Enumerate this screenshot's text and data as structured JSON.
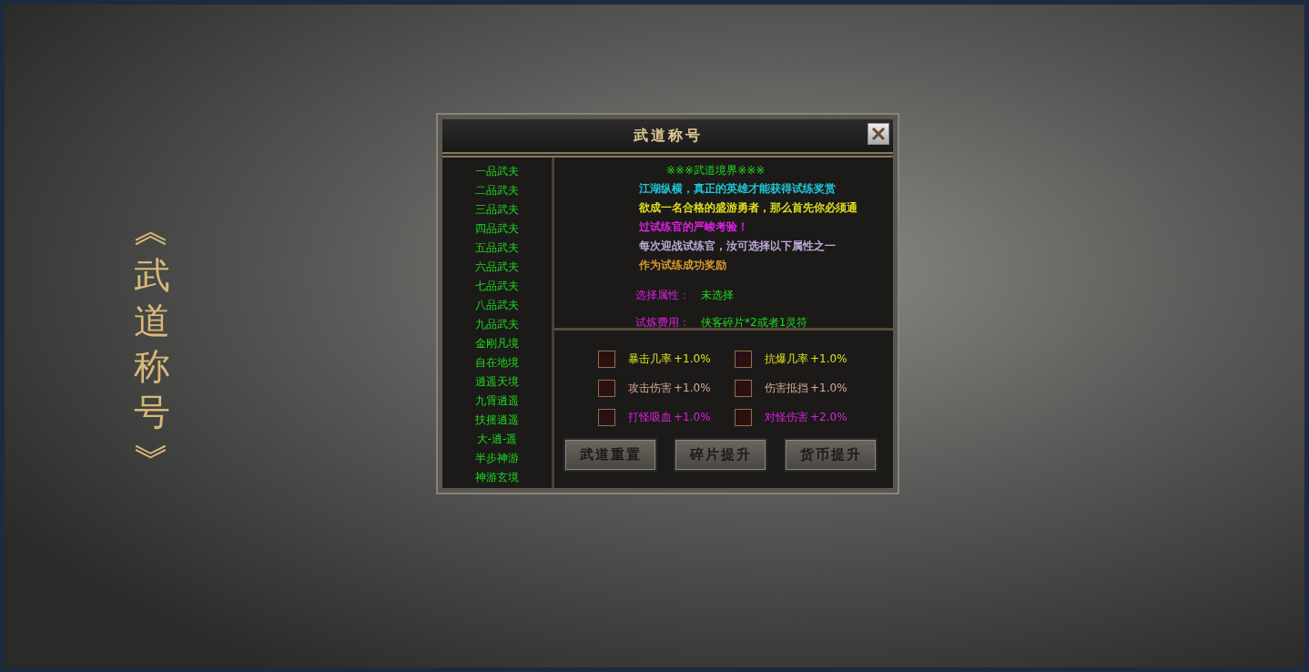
{
  "side_title": "︽武道称号︾",
  "dialog": {
    "title": "武道称号",
    "ranks": [
      {
        "label": "一品武夫"
      },
      {
        "label": "二品武夫"
      },
      {
        "label": "三品武夫"
      },
      {
        "label": "四品武夫"
      },
      {
        "label": "五品武夫"
      },
      {
        "label": "六品武夫"
      },
      {
        "label": "七品武夫"
      },
      {
        "label": "八品武夫"
      },
      {
        "label": "九品武夫"
      },
      {
        "label": "金刚凡境"
      },
      {
        "label": "自在地境"
      },
      {
        "label": "逍遥天境"
      },
      {
        "label": "九霄逍遥"
      },
      {
        "label": "扶摇逍遥"
      },
      {
        "label": "大-逍-遥"
      },
      {
        "label": "半步神游"
      },
      {
        "label": "神游玄境"
      }
    ],
    "heading": "※※※武道境界※※※",
    "intro": [
      {
        "text": "江湖纵横，真正的英雄才能获得试练奖赏",
        "color": "#1ec8d8"
      },
      {
        "text": "欲成一名合格的盛游勇者，那么首先你必须通",
        "color": "#e0e020"
      },
      {
        "text": "过试练官的严峻考验！",
        "color": "#e020e0"
      },
      {
        "text": "每次迎战试练官，汝可选择以下属性之一",
        "color": "#c0a8d8"
      },
      {
        "text": "作为试练成功奖励",
        "color": "#d89830"
      }
    ],
    "selected_attr": {
      "label": "选择属性：",
      "value": "未选择"
    },
    "cost": {
      "label": "试炼费用：",
      "value": "侠客碎片*2或者1灵符"
    },
    "options": [
      {
        "label": "暴击几率",
        "bonus": "+1.0%",
        "checked": false,
        "color": "#e0e020"
      },
      {
        "label": "抗爆几率",
        "bonus": "+1.0%",
        "checked": false,
        "color": "#e0e020"
      },
      {
        "label": "攻击伤害",
        "bonus": "+1.0%",
        "checked": false,
        "color": "#d8a898"
      },
      {
        "label": "伤害抵挡",
        "bonus": "+1.0%",
        "checked": false,
        "color": "#d8a898"
      },
      {
        "label": "打怪吸血",
        "bonus": "+1.0%",
        "checked": false,
        "color": "#e020e0"
      },
      {
        "label": "对怪伤害",
        "bonus": "+2.0%",
        "checked": false,
        "color": "#e020e0"
      }
    ],
    "buttons": [
      "武道重置",
      "碎片提升",
      "货币提升"
    ]
  }
}
